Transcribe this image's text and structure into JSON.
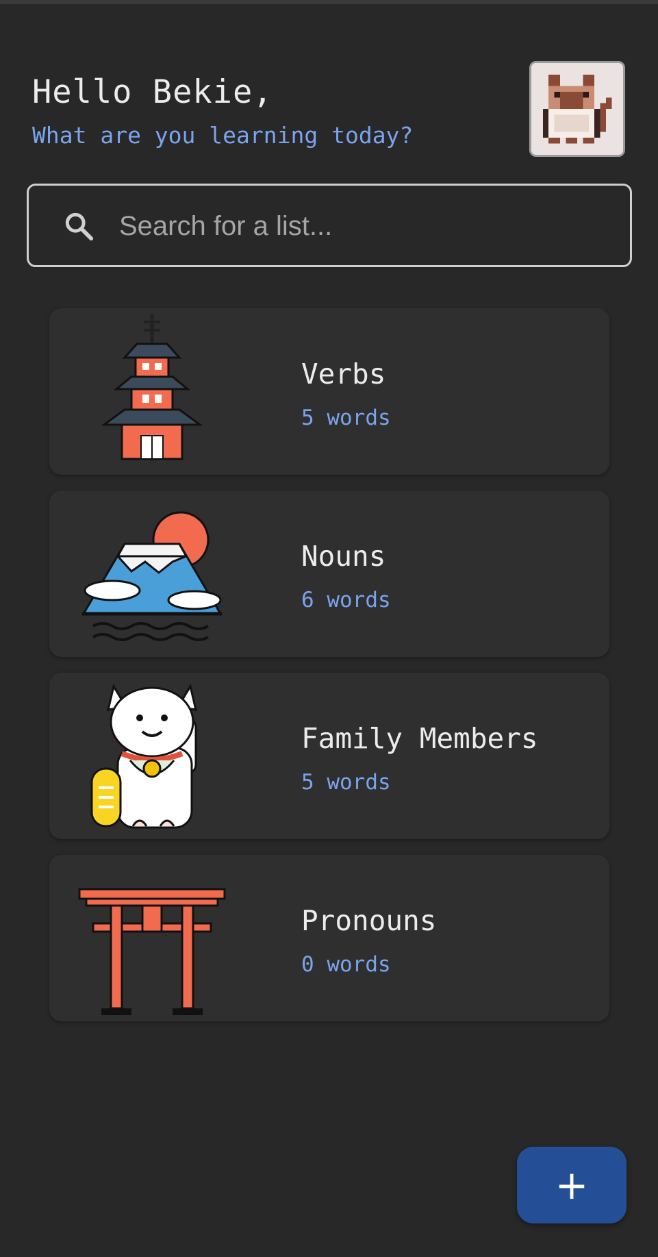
{
  "header": {
    "greeting": "Hello Bekie,",
    "subtitle": "What are you learning today?"
  },
  "avatar": {
    "icon": "pixel-cat-icon"
  },
  "search": {
    "placeholder": "Search for a list...",
    "value": "",
    "icon": "search-icon"
  },
  "lists": [
    {
      "title": "Verbs",
      "count": "5 words",
      "icon": "pagoda-icon"
    },
    {
      "title": "Nouns",
      "count": "6 words",
      "icon": "mount-fuji-icon"
    },
    {
      "title": "Family Members",
      "count": "5 words",
      "icon": "lucky-cat-icon"
    },
    {
      "title": "Pronouns",
      "count": "0 words",
      "icon": "torii-gate-icon"
    }
  ],
  "fab": {
    "label": "+",
    "icon": "add-icon"
  },
  "colors": {
    "background": "#282828",
    "card": "#2f2f2f",
    "accent": "#79a4ee",
    "fab": "#244f97",
    "text": "#ececec"
  }
}
